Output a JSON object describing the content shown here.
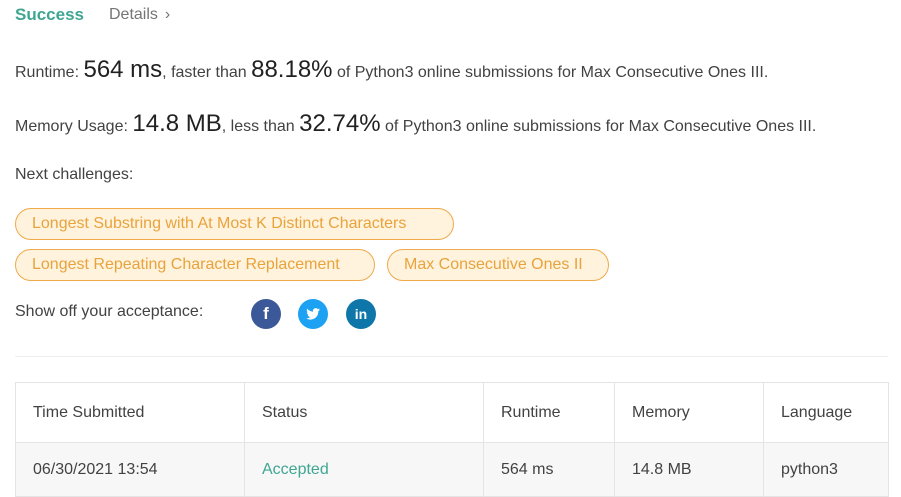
{
  "header": {
    "status": "Success",
    "details_link": "Details",
    "details_chevron": "›"
  },
  "runtime": {
    "label": "Runtime: ",
    "value": "564 ms",
    "comparison": ", faster than ",
    "percent": "88.18%",
    "suffix": " of Python3 online submissions for Max Consecutive Ones III."
  },
  "memory": {
    "label": "Memory Usage: ",
    "value": "14.8 MB",
    "comparison": ", less than ",
    "percent": "32.74%",
    "suffix": " of Python3 online submissions for Max Consecutive Ones III."
  },
  "next_challenges": {
    "title": "Next challenges:",
    "items": [
      "Longest Substring with At Most K Distinct Characters",
      "Longest Repeating Character Replacement",
      "Max Consecutive Ones II"
    ]
  },
  "share": {
    "label": "Show off your acceptance:",
    "icons": [
      {
        "name": "facebook-icon",
        "glyph": "f",
        "color": "#3b5998"
      },
      {
        "name": "twitter-icon",
        "glyph": "🐦",
        "color": "#1da1f2"
      },
      {
        "name": "linkedin-icon",
        "glyph": "in",
        "color": "#0e76a8"
      }
    ]
  },
  "table": {
    "headers": [
      "Time Submitted",
      "Status",
      "Runtime",
      "Memory",
      "Language"
    ],
    "rows": [
      [
        "06/30/2021 13:54",
        "Accepted",
        "564 ms",
        "14.8 MB",
        "python3"
      ]
    ]
  },
  "colors": {
    "accent": "#3fa692",
    "pill_border": "#f0a94a",
    "pill_bg": "#fff3dd",
    "pill_text": "#e8a33d"
  }
}
